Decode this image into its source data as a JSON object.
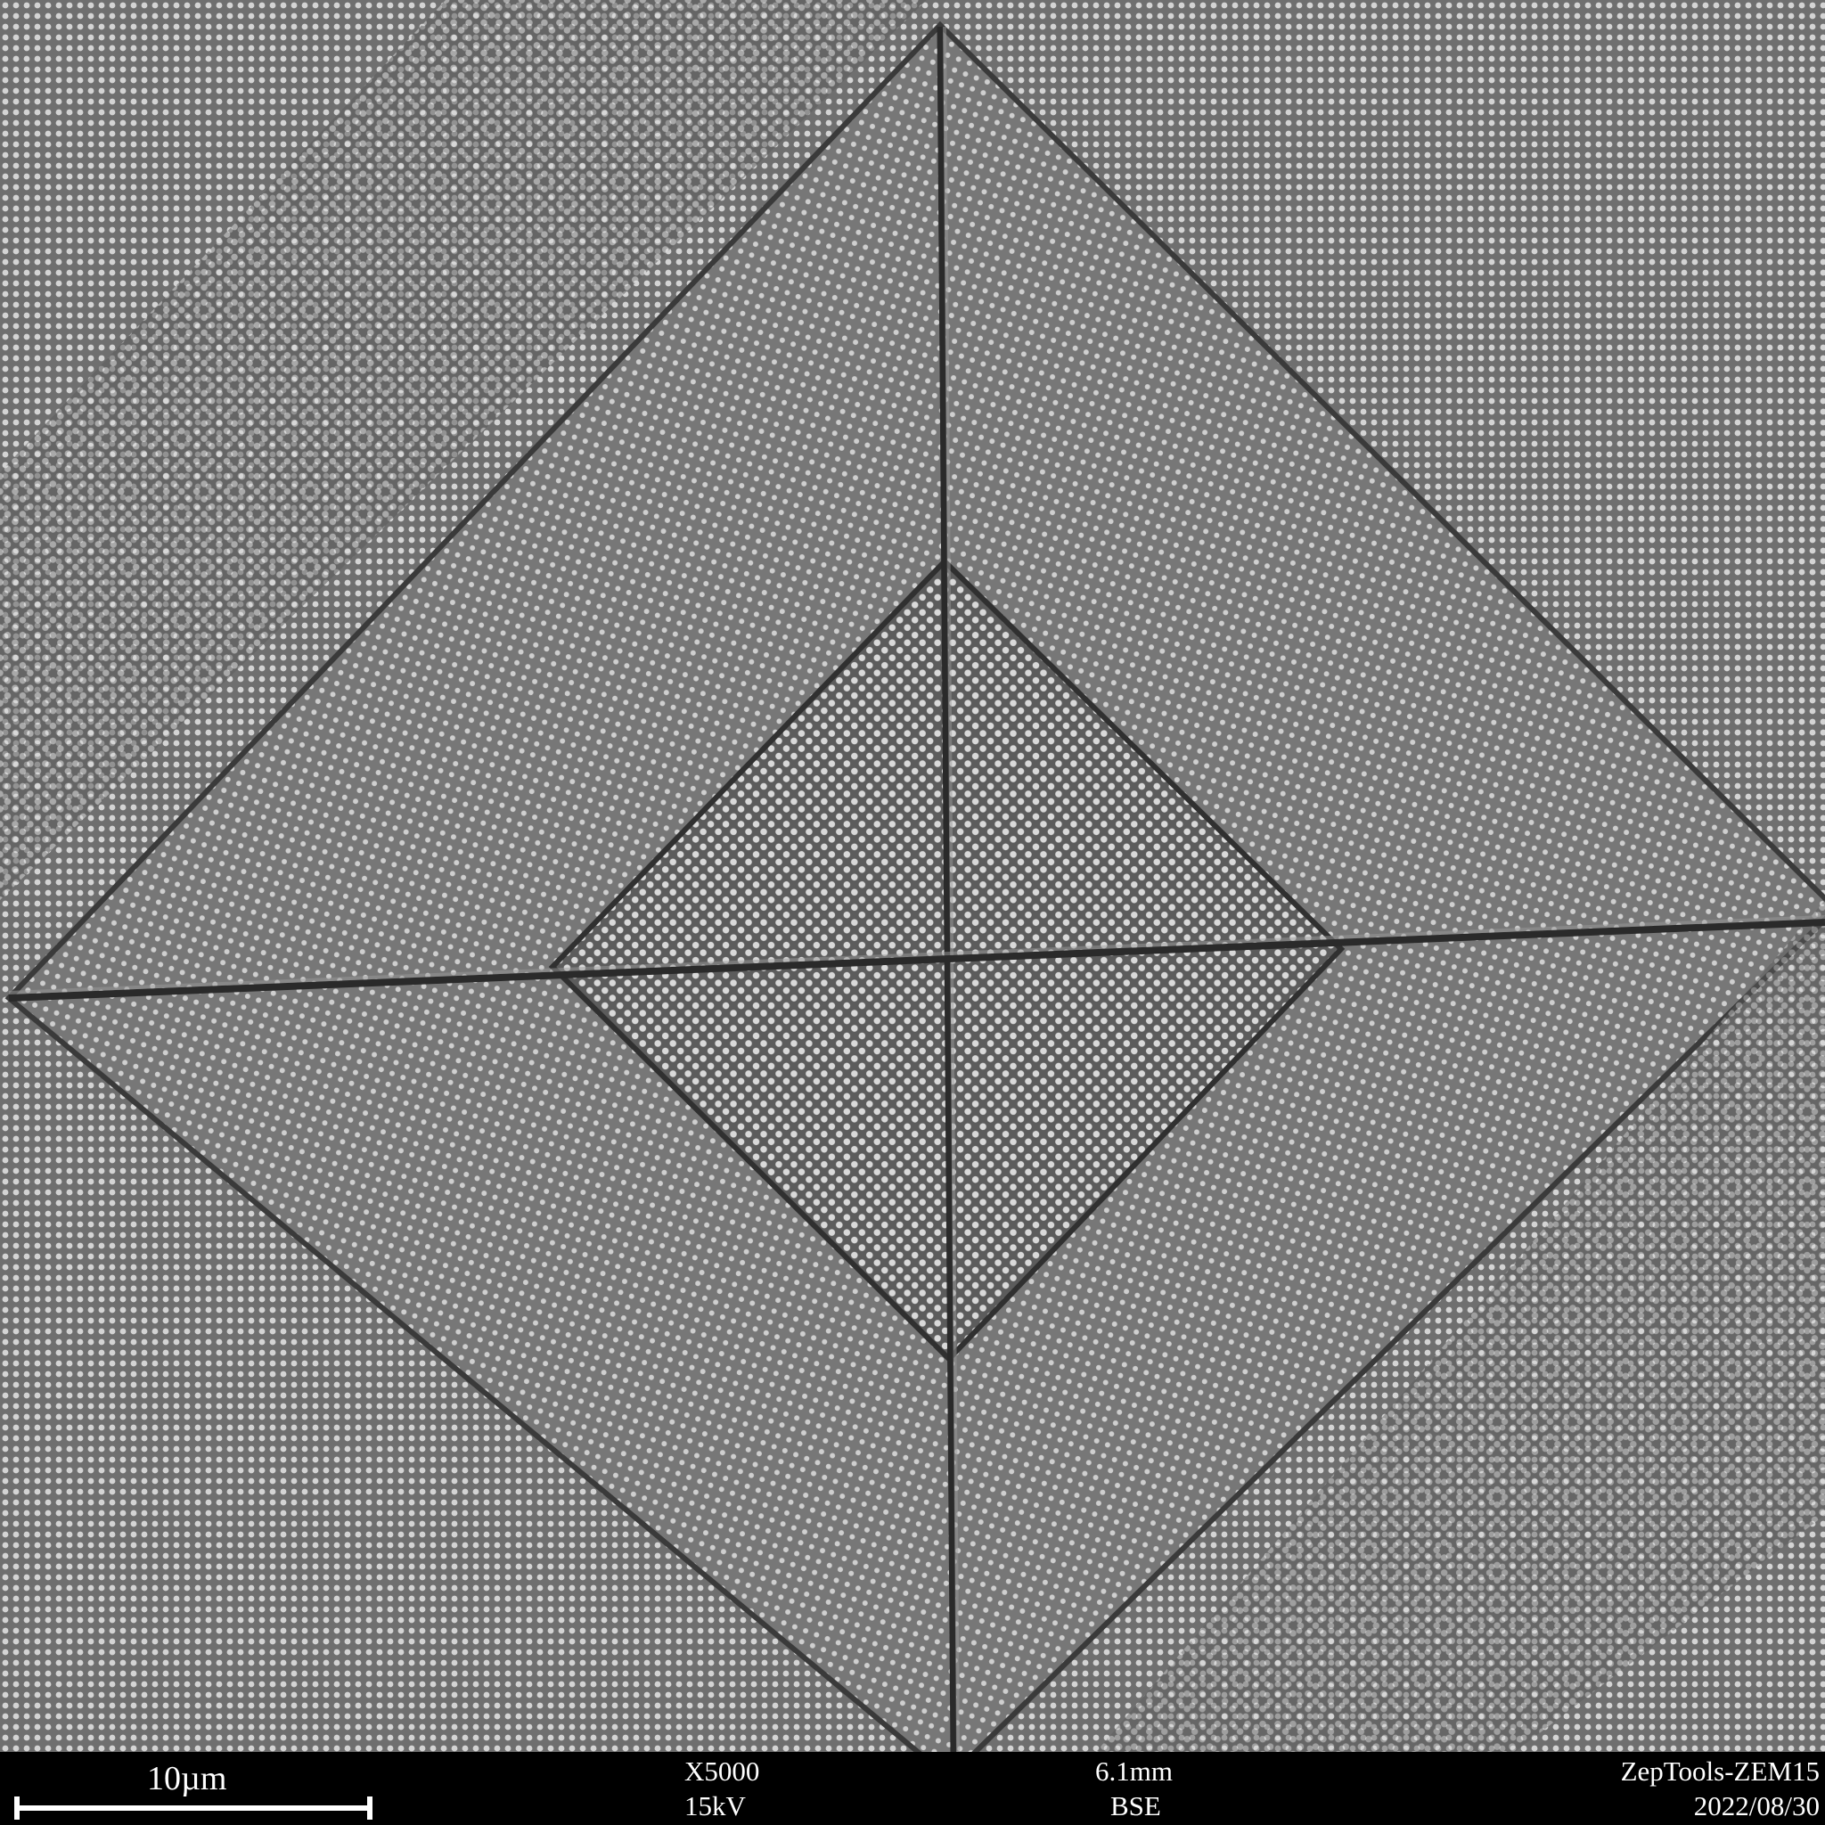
{
  "image": {
    "background_color": "#6f6f6f",
    "dot_color": "#d8d8d8",
    "dark_line_color": "#2a2a2a"
  },
  "info_bar": {
    "scale_label": "10µm",
    "magnification": "X5000",
    "voltage": "15kV",
    "working_distance": "6.1mm",
    "detector": "BSE",
    "instrument": "ZepTools-ZEM15",
    "date": "2022/08/30"
  }
}
